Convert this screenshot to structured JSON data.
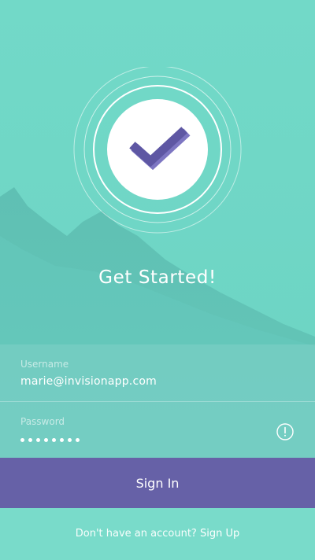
{
  "colors": {
    "background": "#6fd6c5",
    "mountain": "#5fbfb3",
    "accent_purple": "#6661a7",
    "check_mark": "#5e57a3",
    "text": "#ffffff"
  },
  "hero": {
    "icon": "checkmark-icon",
    "title": "Get Started!"
  },
  "form": {
    "username": {
      "label": "Username",
      "value": "marie@invisionapp.com"
    },
    "password": {
      "label": "Password",
      "masked_length": 8,
      "info_icon": "info-icon"
    }
  },
  "actions": {
    "sign_in_label": "Sign In"
  },
  "footer": {
    "prompt": "Don't have an account?",
    "link_label": "Sign Up"
  }
}
